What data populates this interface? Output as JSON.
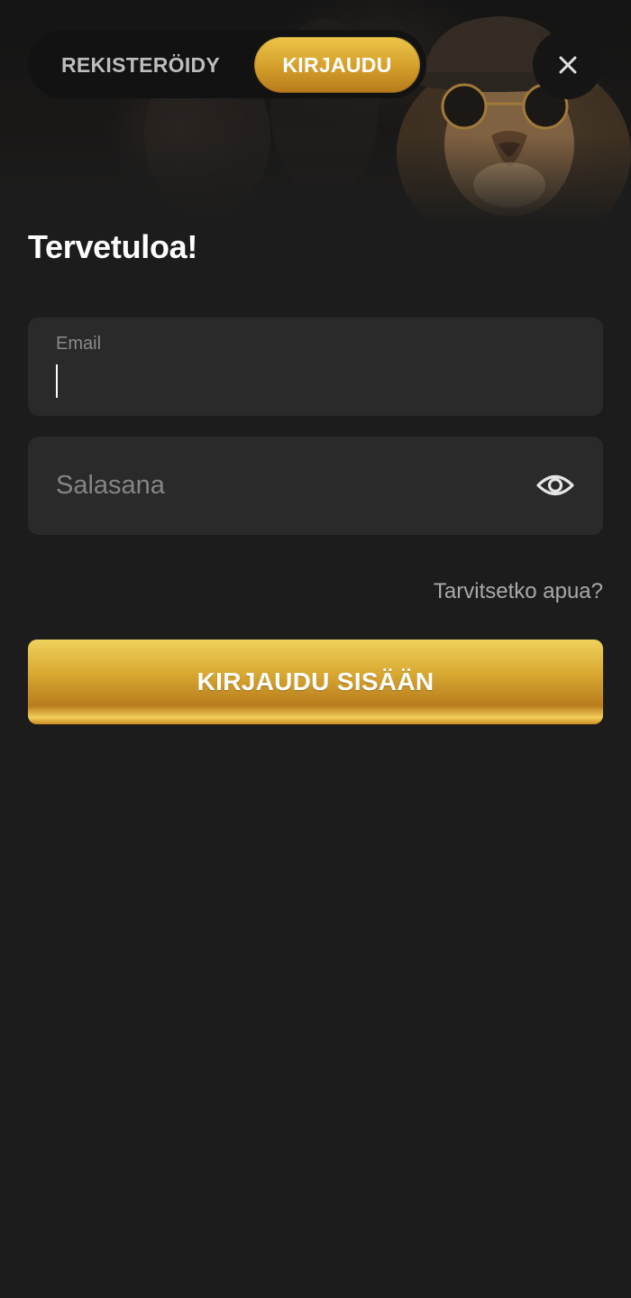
{
  "tabs": {
    "register_label": "REKISTERÖIDY",
    "login_label": "KIRJAUDU",
    "active": "login"
  },
  "close": {
    "icon": "close-icon"
  },
  "form": {
    "title": "Tervetuloa!",
    "email": {
      "label": "Email",
      "value": ""
    },
    "password": {
      "placeholder": "Salasana",
      "value": "",
      "toggle_icon": "eye-icon"
    },
    "help_link": "Tarvitsetko apua?",
    "submit_label": "KIRJAUDU SISÄÄN"
  },
  "colors": {
    "background": "#1c1c1c",
    "field_background": "#2a2a2a",
    "accent_gold": "#d9a932",
    "text_primary": "#ffffff",
    "text_muted": "#8a8a8a"
  }
}
